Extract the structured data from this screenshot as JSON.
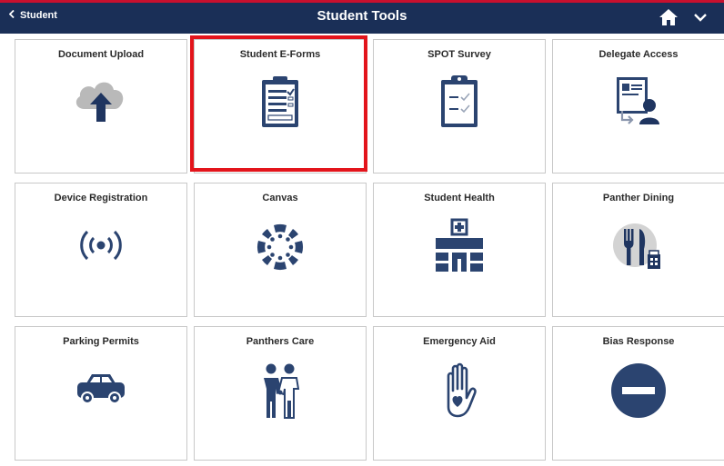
{
  "header": {
    "back_label": "Student",
    "title": "Student Tools",
    "home_icon": "home-icon",
    "menu_icon": "chevron-down-icon"
  },
  "tiles": [
    {
      "label": "Document Upload",
      "icon": "cloud-upload-icon"
    },
    {
      "label": "Student E-Forms",
      "icon": "clipboard-form-icon"
    },
    {
      "label": "SPOT Survey",
      "icon": "clipboard-check-icon"
    },
    {
      "label": "Delegate Access",
      "icon": "delegate-user-icon"
    },
    {
      "label": "Device Registration",
      "icon": "wireless-signal-icon"
    },
    {
      "label": "Canvas",
      "icon": "canvas-logo-icon"
    },
    {
      "label": "Student Health",
      "icon": "hospital-icon"
    },
    {
      "label": "Panther Dining",
      "icon": "fork-knife-icon"
    },
    {
      "label": "Parking Permits",
      "icon": "car-icon"
    },
    {
      "label": "Panthers Care",
      "icon": "people-holding-hands-icon"
    },
    {
      "label": "Emergency Aid",
      "icon": "hand-heart-icon"
    },
    {
      "label": "Bias Response",
      "icon": "minus-circle-icon"
    }
  ],
  "colors": {
    "header_bg": "#1a2f57",
    "icon_navy": "#2b4470",
    "highlight": "#e3141b"
  }
}
